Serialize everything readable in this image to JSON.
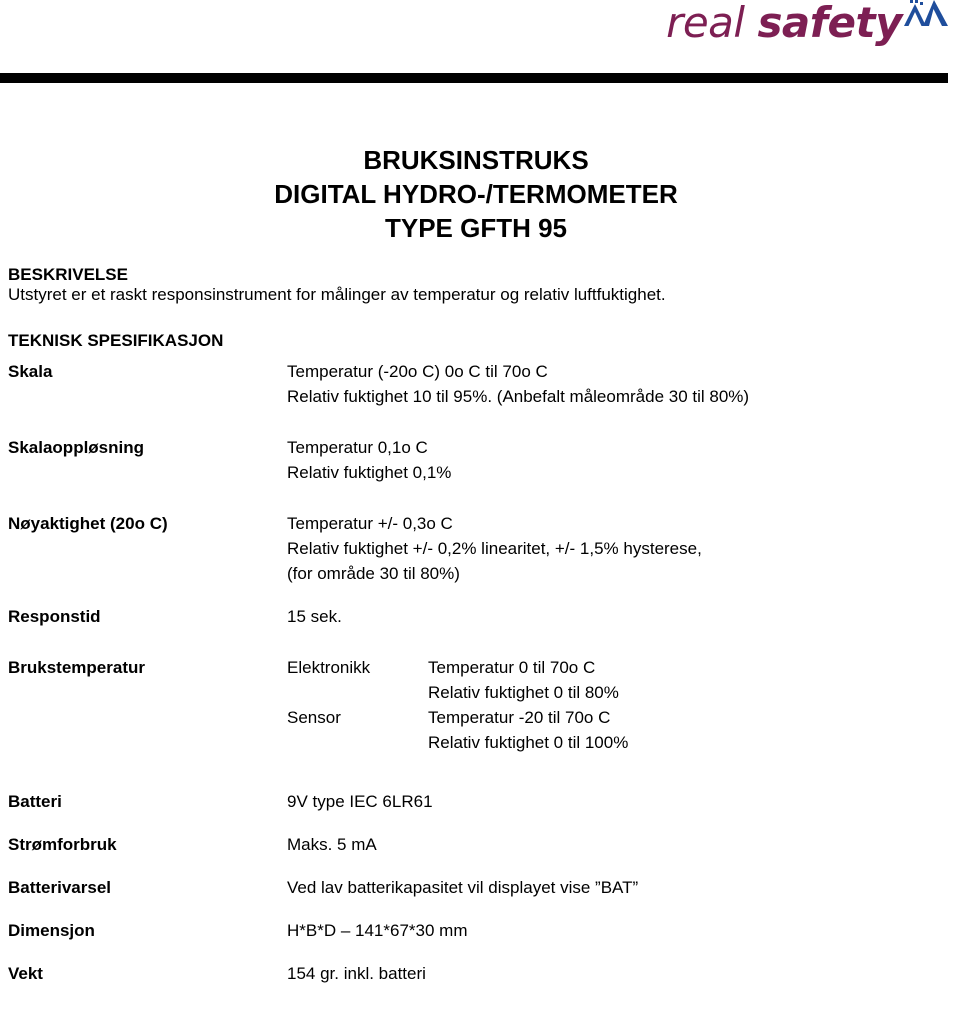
{
  "brand": {
    "name_part1": "real ",
    "name_part2": "safety",
    "mark": "mountain-m-logo",
    "color_text": "#7d1f53",
    "color_mark": "#1f4e9c",
    "rule_color": "#000000"
  },
  "title": {
    "line1": "BRUKSINSTRUKS",
    "line2": "DIGITAL HYDRO-/TERMOMETER",
    "line3": "TYPE GFTH 95"
  },
  "description": {
    "heading": "BESKRIVELSE",
    "text": "Utstyret er et raskt responsinstrument for målinger av temperatur og relativ luftfuktighet."
  },
  "spec": {
    "heading": "TEKNISK SPESIFIKASJON",
    "rows": [
      {
        "label": "Skala",
        "lines": [
          "Temperatur (-20o C) 0o C til 70o C",
          "Relativ fuktighet 10 til 95%. (Anbefalt måleområde 30 til 80%)"
        ]
      },
      {
        "label": "Skalaoppløsning",
        "lines": [
          "Temperatur 0,1o C",
          "Relativ fuktighet 0,1%"
        ]
      },
      {
        "label": "Nøyaktighet (20o C)",
        "lines": [
          "Temperatur +/- 0,3o C",
          "Relativ fuktighet +/- 0,2% linearitet, +/- 1,5% hysterese,",
          "(for område 30 til 80%)"
        ]
      },
      {
        "label": "Responstid",
        "lines": [
          "15 sek."
        ]
      }
    ],
    "operating": {
      "label": "Brukstemperatur",
      "groups": [
        {
          "key": "Elektronikk",
          "lines": [
            "Temperatur 0 til 70o C",
            "Relativ fuktighet 0 til 80%"
          ]
        },
        {
          "key": "Sensor",
          "lines": [
            "Temperatur -20 til 70o C",
            "Relativ fuktighet 0 til 100%"
          ]
        }
      ]
    },
    "rows2": [
      {
        "label": "Batteri",
        "lines": [
          "9V type IEC 6LR61"
        ]
      },
      {
        "label": "Strømforbruk",
        "lines": [
          "Maks. 5 mA"
        ]
      },
      {
        "label": "Batterivarsel",
        "lines": [
          "Ved lav batterikapasitet vil displayet vise ”BAT”"
        ]
      },
      {
        "label": "Dimensjon",
        "lines": [
          "H*B*D – 141*67*30 mm"
        ]
      },
      {
        "label": "Vekt",
        "lines": [
          "154 gr. inkl. batteri"
        ]
      }
    ]
  }
}
